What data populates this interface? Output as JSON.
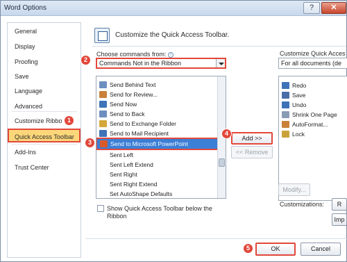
{
  "window": {
    "title": "Word Options",
    "help_button": "?",
    "close_button": "✕"
  },
  "nav": {
    "items": [
      {
        "label": "General"
      },
      {
        "label": "Display"
      },
      {
        "label": "Proofing"
      },
      {
        "label": "Save"
      },
      {
        "label": "Language"
      },
      {
        "label": "Advanced"
      },
      {
        "label": "Customize Ribbo"
      },
      {
        "label": "Quick Access Toolbar",
        "selected": true
      },
      {
        "label": "Add-Ins"
      },
      {
        "label": "Trust Center"
      }
    ]
  },
  "main": {
    "header": "Customize the Quick Access Toolbar.",
    "choose_label": "Choose commands from:",
    "info_icon": "i",
    "choose_value": "Commands Not in the Ribbon",
    "commands": [
      {
        "label": "Send Behind Text",
        "icon": "send-behind-icon",
        "color": "#6d8fbf"
      },
      {
        "label": "Send for Review...",
        "icon": "review-icon",
        "color": "#c9813a"
      },
      {
        "label": "Send Now",
        "icon": "mail-icon",
        "color": "#3f73b8"
      },
      {
        "label": "Send to Back",
        "icon": "send-back-icon",
        "color": "#6d8fbf"
      },
      {
        "label": "Send to Exchange Folder",
        "icon": "exchange-icon",
        "color": "#d3a73a"
      },
      {
        "label": "Send to Mail Recipient",
        "icon": "mail-recipient-icon",
        "color": "#3f73b8"
      },
      {
        "label": "Send to Microsoft PowerPoint",
        "icon": "powerpoint-icon",
        "color": "#d85a2a",
        "selected": true
      },
      {
        "label": "Sent Left",
        "icon": "",
        "color": ""
      },
      {
        "label": "Sent Left Extend",
        "icon": "",
        "color": ""
      },
      {
        "label": "Sent Right",
        "icon": "",
        "color": ""
      },
      {
        "label": "Sent Right Extend",
        "icon": "",
        "color": ""
      },
      {
        "label": "Set AutoShape Defaults",
        "icon": "",
        "color": ""
      }
    ],
    "add_button": "Add >>",
    "remove_button": "<< Remove",
    "show_below_label": "Show Quick Access Toolbar below the",
    "show_below_label_2": "Ribbon",
    "customize_label": "Customize Quick Acces",
    "scope_value": "For all documents (de",
    "toolbar_items": [
      {
        "label": "Redo",
        "icon": "redo-icon",
        "color": "#3f73b8"
      },
      {
        "label": "Save",
        "icon": "save-icon",
        "color": "#4a6fa8"
      },
      {
        "label": "Undo",
        "icon": "undo-icon",
        "color": "#3f73b8"
      },
      {
        "label": "Shrink One Page",
        "icon": "shrink-page-icon",
        "color": "#8a9bb5"
      },
      {
        "label": "AutoFormat...",
        "icon": "autoformat-icon",
        "color": "#c9813a"
      },
      {
        "label": "Lock",
        "icon": "lock-icon",
        "color": "#c9a23a"
      }
    ],
    "modify_button": "Modify...",
    "customizations_label": "Customizations:",
    "reset_button": "R",
    "import_button": "Imp"
  },
  "footer": {
    "ok_button": "OK",
    "cancel_button": "Cancel"
  },
  "annotations": {
    "step1": "1",
    "step2": "2",
    "step3": "3",
    "step4": "4",
    "step5": "5",
    "color": "#e2473a"
  }
}
